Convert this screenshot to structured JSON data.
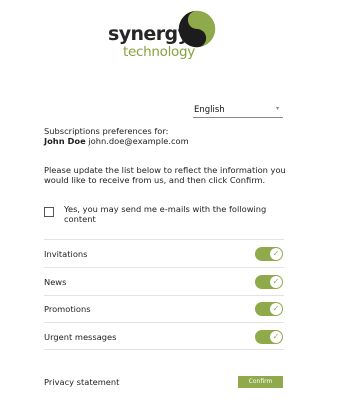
{
  "brand": {
    "name_part1": "synergy",
    "name_part2": "technology",
    "primary_color": "#8faa4b",
    "dark_color": "#262626"
  },
  "language": {
    "selected": "English",
    "caret": "▾"
  },
  "subscription": {
    "label": "Subscriptions preferences for:",
    "user_name": "John Doe",
    "user_email": "john.doe@example.com",
    "instructions": "Please update the list below to reflect the information you would like to receive from us, and then click Confirm."
  },
  "consent": {
    "text": "Yes, you may send me e-mails with the following content",
    "checked": false
  },
  "preferences": [
    {
      "label": "Invitations",
      "enabled": true
    },
    {
      "label": "News",
      "enabled": true
    },
    {
      "label": "Promotions",
      "enabled": true
    },
    {
      "label": "Urgent messages",
      "enabled": true
    }
  ],
  "footer": {
    "privacy": "Privacy statement",
    "confirm": "Confirm"
  },
  "icons": {
    "toggle_check": "check-icon",
    "logo_mark": "yin-yang-icon"
  }
}
